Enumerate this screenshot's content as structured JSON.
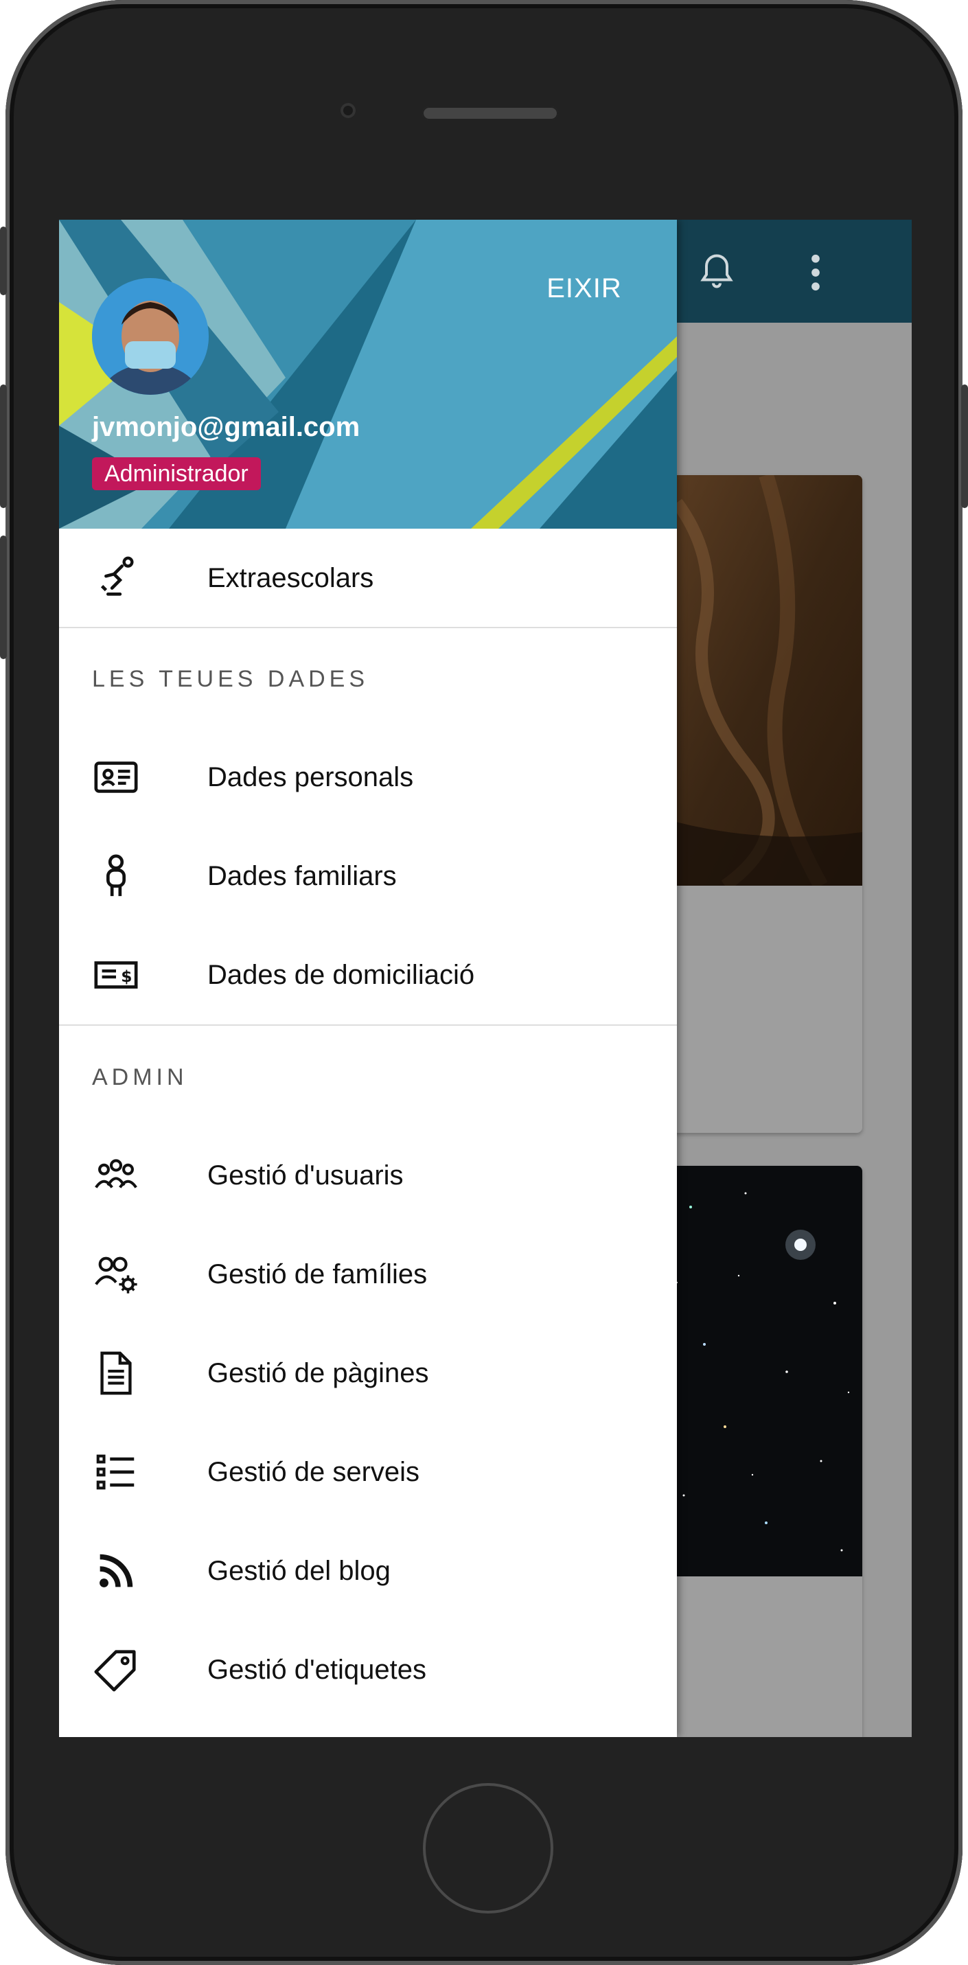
{
  "drawer": {
    "header": {
      "exit_label": "EIXIR",
      "email": "jvmonjo@gmail.com",
      "role": "Administrador"
    },
    "top_items": [
      {
        "label": "Extraescolars",
        "icon": "ice-skating-icon"
      }
    ],
    "sections": [
      {
        "title": "LES TEUES DADES",
        "items": [
          {
            "label": "Dades personals",
            "icon": "id-card-icon"
          },
          {
            "label": "Dades familiars",
            "icon": "person-outline-icon"
          },
          {
            "label": "Dades de domiciliació",
            "icon": "money-card-icon"
          }
        ]
      },
      {
        "title": "ADMIN",
        "items": [
          {
            "label": "Gestió d'usuaris",
            "icon": "group-icon"
          },
          {
            "label": "Gestió de famílies",
            "icon": "group-settings-icon"
          },
          {
            "label": "Gestió de pàgines",
            "icon": "document-icon"
          },
          {
            "label": "Gestió de serveis",
            "icon": "list-icon"
          },
          {
            "label": "Gestió del blog",
            "icon": "rss-icon"
          },
          {
            "label": "Gestió d'etiquetes",
            "icon": "tag-icon"
          }
        ]
      }
    ]
  },
  "appbar": {
    "icons": [
      "bell-icon",
      "more-vertical-icon"
    ]
  },
  "colors": {
    "appbar": "#143f4f",
    "badge": "#c2185b",
    "header": "#1d6a86"
  }
}
